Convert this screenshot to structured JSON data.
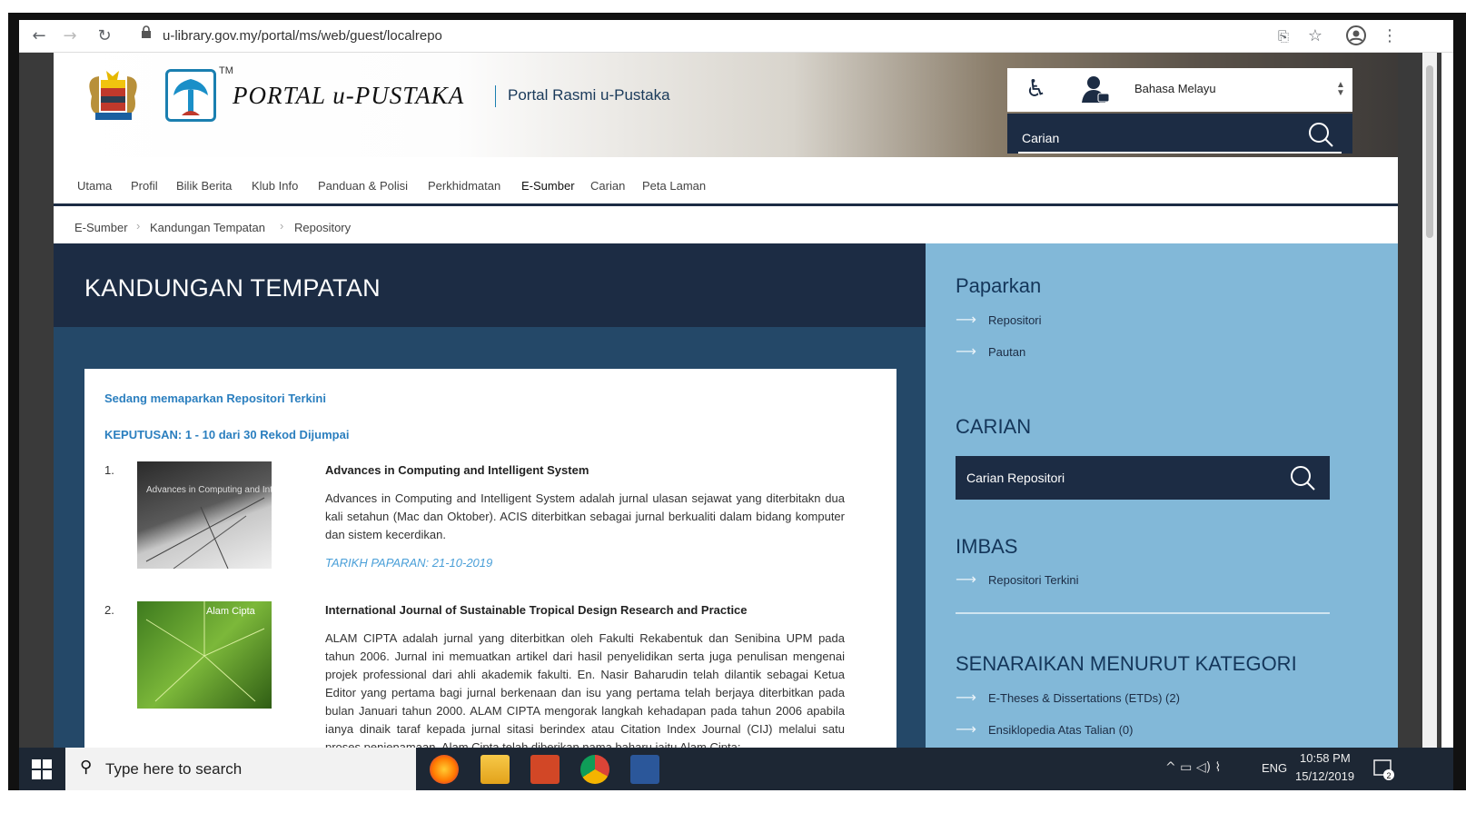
{
  "browser": {
    "url": "u-library.gov.my/portal/ms/web/guest/localrepo"
  },
  "header": {
    "tm": "TM",
    "title": "PORTAL u-PUSTAKA",
    "subtitle": "Portal Rasmi u-Pustaka",
    "language": "Bahasa Melayu",
    "search_placeholder": "Carian"
  },
  "nav": {
    "items": [
      "Utama",
      "Profil",
      "Bilik Berita",
      "Klub Info",
      "Panduan & Polisi",
      "Perkhidmatan",
      "E-Sumber",
      "Carian",
      "Peta Laman"
    ]
  },
  "breadcrumb": [
    "E-Sumber",
    "Kandungan Tempatan",
    "Repository"
  ],
  "main": {
    "title": "KANDUNGAN TEMPATAN",
    "showing": "Sedang memaparkan Repositori Terkini",
    "results": "KEPUTUSAN: 1 - 10 dari 30 Rekod Dijumpai",
    "items": [
      {
        "num": "1.",
        "thumb_text": "Advances in Computing and Intelligent System",
        "title": "Advances in Computing and Intelligent System",
        "desc": "Advances in Computing and Intelligent System adalah jurnal ulasan sejawat yang diterbitakn dua kali setahun (Mac dan Oktober). ACIS diterbitkan sebagai jurnal berkualiti dalam bidang komputer dan sistem kecerdikan.",
        "date": "TARIKH PAPARAN: 21-10-2019"
      },
      {
        "num": "2.",
        "thumb_text": "Alam Cipta",
        "title": "International Journal of Sustainable Tropical Design Research and Practice",
        "desc": "ALAM CIPTA adalah jurnal yang diterbitkan oleh Fakulti Rekabentuk dan Senibina UPM pada tahun 2006. Jurnal ini memuatkan artikel dari hasil penyelidikan serta juga penulisan mengenai projek professional dari ahli akademik fakulti. En. Nasir Baharudin telah dilantik sebagai Ketua Editor yang pertama bagi jurnal berkenaan dan isu yang pertama telah berjaya diterbitkan pada bulan Januari tahun 2000. ALAM CIPTA mengorak langkah kehadapan pada tahun 2006 apabila ianya dinaik taraf kepada jurnal sitasi berindex atau Citation Index Journal (CIJ) melalui satu proses penjenamaan. Alam Cipta telah diberikan nama baharu iaitu Alam Cipta:"
      }
    ]
  },
  "sidebar": {
    "paparkan_title": "Paparkan",
    "paparkan_links": [
      "Repositori",
      "Pautan"
    ],
    "carian_title": "CARIAN",
    "carian_placeholder": "Carian Repositori",
    "imbas_title": "IMBAS",
    "imbas_links": [
      "Repositori Terkini"
    ],
    "kategori_title": "SENARAIKAN MENURUT KATEGORI",
    "kategori_links": [
      "E-Theses & Dissertations (ETDs) (2)",
      "Ensiklopedia Atas Talian (0)"
    ]
  },
  "taskbar": {
    "search_placeholder": "Type here to search",
    "lang": "ENG",
    "time": "10:58 PM",
    "date": "15/12/2019",
    "notif_count": "2"
  }
}
